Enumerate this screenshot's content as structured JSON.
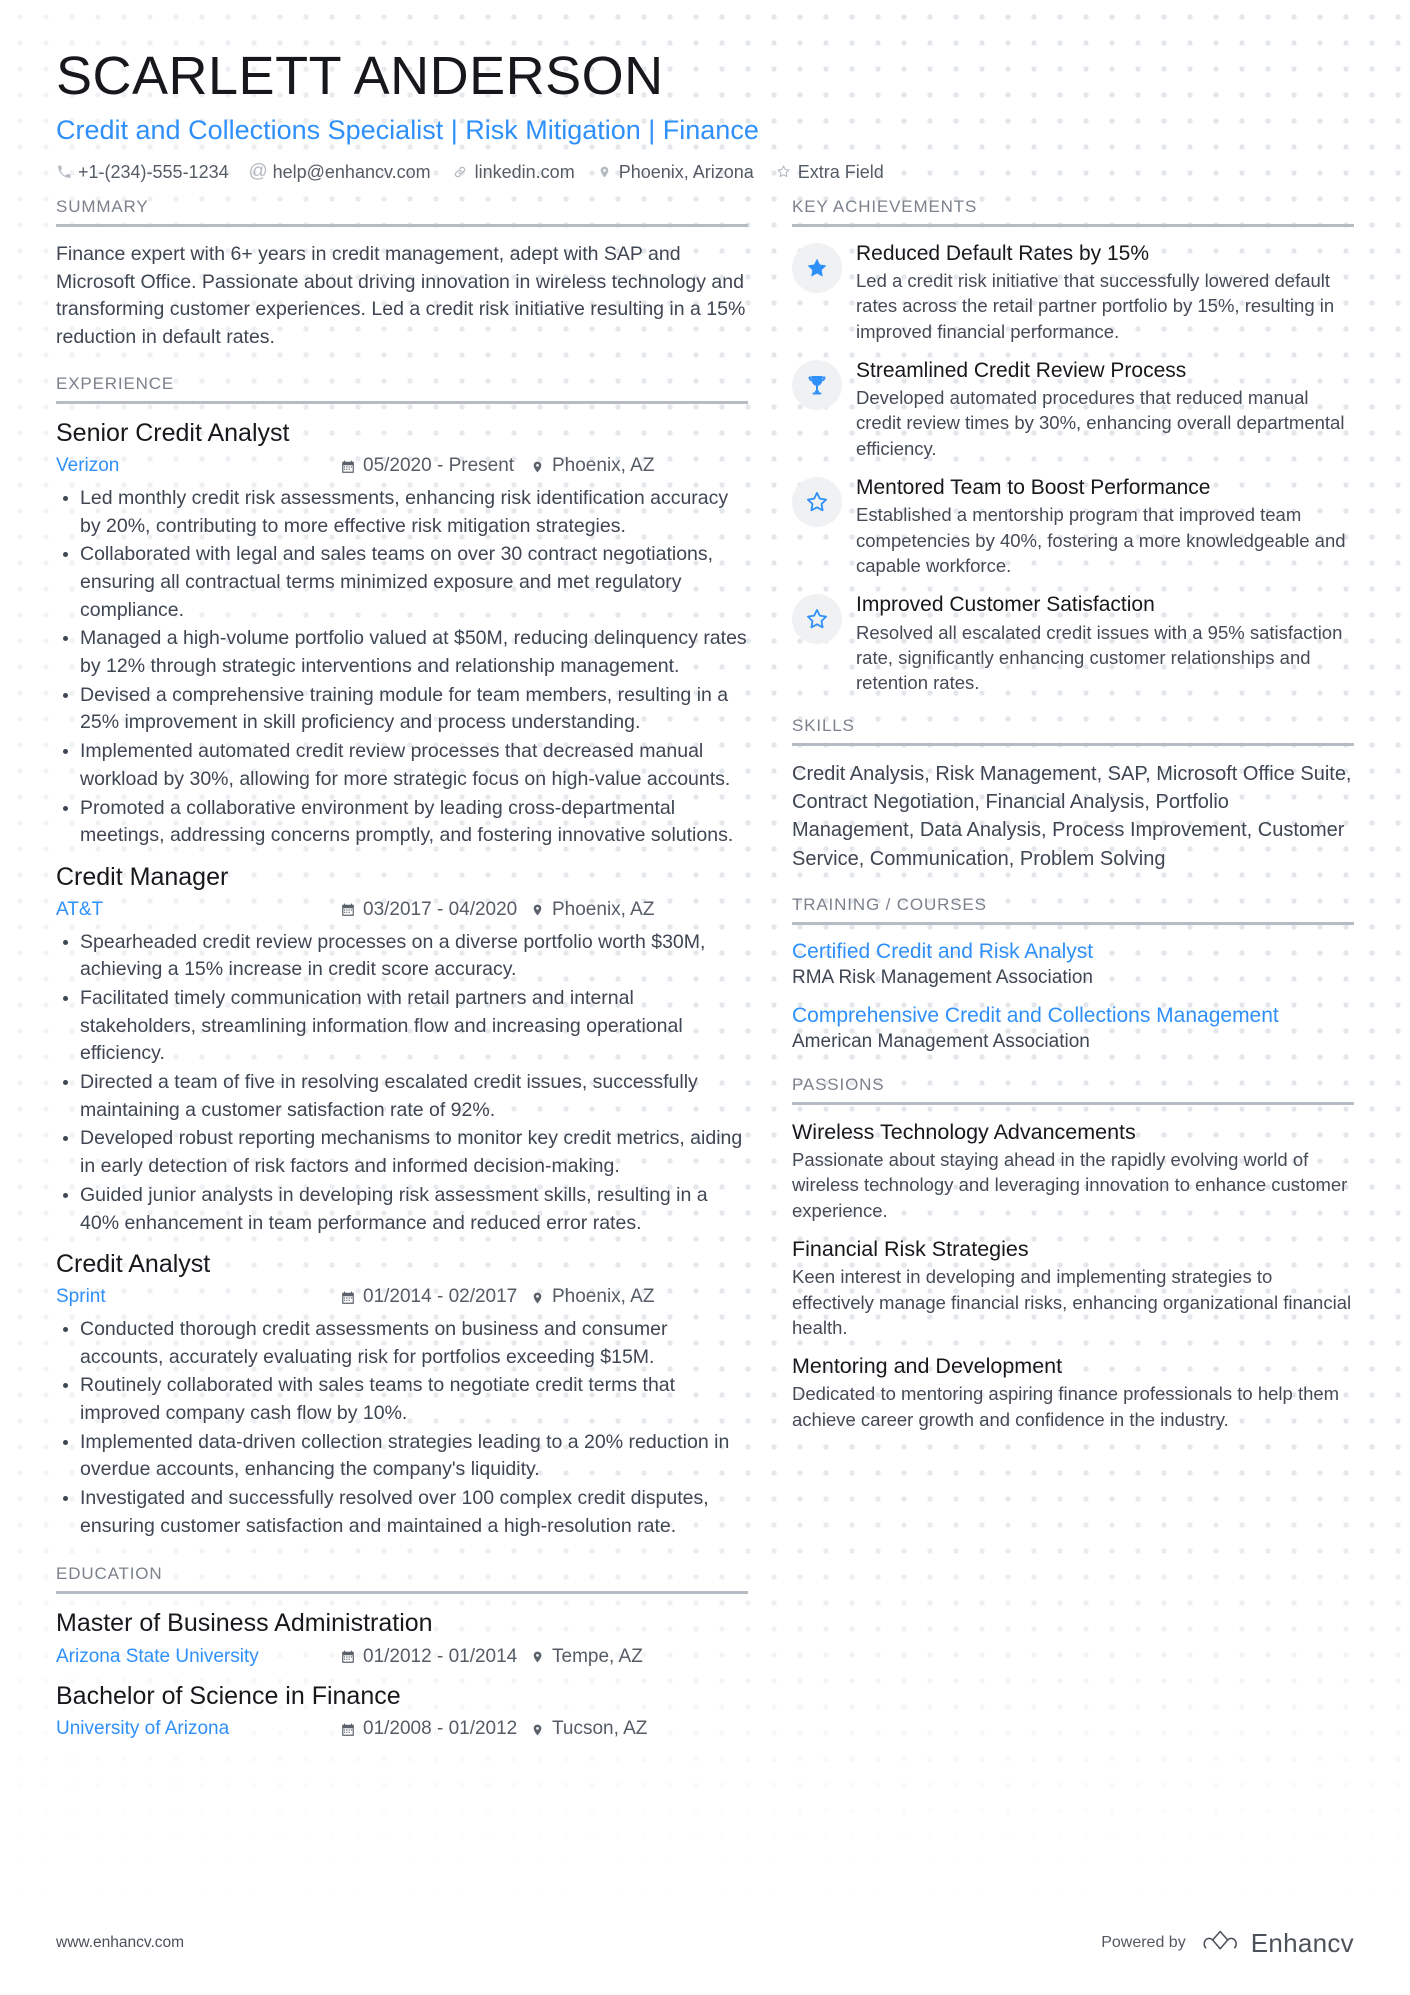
{
  "theme": {
    "accent": "#2f90fa",
    "heading_gray": "#7b828c",
    "rule_gray": "#b6bcc3",
    "text": "#3e4653",
    "dot": "#e3e6ea"
  },
  "header": {
    "name": "SCARLETT ANDERSON",
    "headline": "Credit and Collections Specialist | Risk Mitigation | Finance",
    "contacts": [
      {
        "icon": "phone-icon",
        "text": "+1-(234)-555-1234"
      },
      {
        "icon": "email-icon",
        "text": "help@enhancv.com"
      },
      {
        "icon": "link-icon",
        "text": "linkedin.com"
      },
      {
        "icon": "location-pin-icon",
        "text": "Phoenix, Arizona"
      },
      {
        "icon": "star-outline-icon",
        "text": "Extra Field"
      }
    ]
  },
  "left": {
    "summary": {
      "title": "SUMMARY",
      "text": "Finance expert with 6+ years in credit management, adept with SAP and Microsoft Office. Passionate about driving innovation in wireless technology and transforming customer experiences. Led a credit risk initiative resulting in a 15% reduction in default rates."
    },
    "experience": {
      "title": "EXPERIENCE",
      "entries": [
        {
          "role": "Senior Credit Analyst",
          "company": "Verizon",
          "dates": "05/2020 - Present",
          "location": "Phoenix, AZ",
          "bullets": [
            "Led monthly credit risk assessments, enhancing risk identification accuracy by 20%, contributing to more effective risk mitigation strategies.",
            "Collaborated with legal and sales teams on over 30 contract negotiations, ensuring all contractual terms minimized exposure and met regulatory compliance.",
            "Managed a high-volume portfolio valued at $50M, reducing delinquency rates by 12% through strategic interventions and relationship management.",
            "Devised a comprehensive training module for team members, resulting in a 25% improvement in skill proficiency and process understanding.",
            "Implemented automated credit review processes that decreased manual workload by 30%, allowing for more strategic focus on high-value accounts.",
            "Promoted a collaborative environment by leading cross-departmental meetings, addressing concerns promptly, and fostering innovative solutions."
          ]
        },
        {
          "role": "Credit Manager",
          "company": "AT&T",
          "dates": "03/2017 - 04/2020",
          "location": "Phoenix, AZ",
          "bullets": [
            "Spearheaded credit review processes on a diverse portfolio worth $30M, achieving a 15% increase in credit score accuracy.",
            "Facilitated timely communication with retail partners and internal stakeholders, streamlining information flow and increasing operational efficiency.",
            "Directed a team of five in resolving escalated credit issues, successfully maintaining a customer satisfaction rate of 92%.",
            "Developed robust reporting mechanisms to monitor key credit metrics, aiding in early detection of risk factors and informed decision-making.",
            "Guided junior analysts in developing risk assessment skills, resulting in a 40% enhancement in team performance and reduced error rates."
          ]
        },
        {
          "role": "Credit Analyst",
          "company": "Sprint",
          "dates": "01/2014 - 02/2017",
          "location": "Phoenix, AZ",
          "bullets": [
            "Conducted thorough credit assessments on business and consumer accounts, accurately evaluating risk for portfolios exceeding $15M.",
            "Routinely collaborated with sales teams to negotiate credit terms that improved company cash flow by 10%.",
            "Implemented data-driven collection strategies leading to a 20% reduction in overdue accounts, enhancing the company's liquidity.",
            "Investigated and successfully resolved over 100 complex credit disputes, ensuring customer satisfaction and maintained a high-resolution rate."
          ]
        }
      ]
    },
    "education": {
      "title": "EDUCATION",
      "entries": [
        {
          "degree": "Master of Business Administration",
          "school": "Arizona State University",
          "dates": "01/2012 - 01/2014",
          "location": "Tempe, AZ"
        },
        {
          "degree": "Bachelor of Science in Finance",
          "school": "University of Arizona",
          "dates": "01/2008 - 01/2012",
          "location": "Tucson, AZ"
        }
      ]
    }
  },
  "right": {
    "achievements": {
      "title": "KEY ACHIEVEMENTS",
      "items": [
        {
          "icon": "star-filled-icon",
          "title": "Reduced Default Rates by 15%",
          "text": "Led a credit risk initiative that successfully lowered default rates across the retail partner portfolio by 15%, resulting in improved financial performance."
        },
        {
          "icon": "trophy-icon",
          "title": "Streamlined Credit Review Process",
          "text": "Developed automated procedures that reduced manual credit review times by 30%, enhancing overall departmental efficiency."
        },
        {
          "icon": "star-outline-icon",
          "title": "Mentored Team to Boost Performance",
          "text": "Established a mentorship program that improved team competencies by 40%, fostering a more knowledgeable and capable workforce."
        },
        {
          "icon": "star-outline-icon",
          "title": "Improved Customer Satisfaction",
          "text": "Resolved all escalated credit issues with a 95% satisfaction rate, significantly enhancing customer relationships and retention rates."
        }
      ]
    },
    "skills": {
      "title": "SKILLS",
      "text": "Credit Analysis, Risk Management, SAP, Microsoft Office Suite, Contract Negotiation, Financial Analysis, Portfolio Management, Data Analysis, Process Improvement, Customer Service, Communication, Problem Solving"
    },
    "training": {
      "title": "TRAINING / COURSES",
      "items": [
        {
          "name": "Certified Credit and Risk Analyst",
          "org": "RMA Risk Management Association"
        },
        {
          "name": "Comprehensive Credit and Collections Management",
          "org": "American Management Association"
        }
      ]
    },
    "passions": {
      "title": "PASSIONS",
      "items": [
        {
          "title": "Wireless Technology Advancements",
          "text": "Passionate about staying ahead in the rapidly evolving world of wireless technology and leveraging innovation to enhance customer experience."
        },
        {
          "title": "Financial Risk Strategies",
          "text": "Keen interest in developing and implementing strategies to effectively manage financial risks, enhancing organizational financial health."
        },
        {
          "title": "Mentoring and Development",
          "text": "Dedicated to mentoring aspiring finance professionals to help them achieve career growth and confidence in the industry."
        }
      ]
    }
  },
  "footer": {
    "url": "www.enhancv.com",
    "powered_by": "Powered by",
    "brand": "Enhancv"
  }
}
